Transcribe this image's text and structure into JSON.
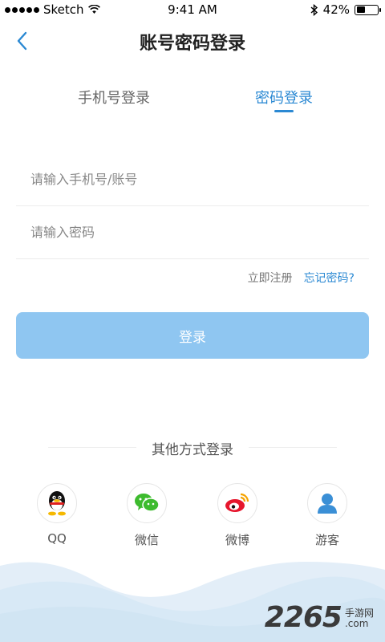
{
  "status_bar": {
    "carrier": "Sketch",
    "time": "9:41 AM",
    "battery": "42%",
    "battery_level": 0.42
  },
  "header": {
    "title": "账号密码登录"
  },
  "tabs": [
    {
      "label": "手机号登录",
      "active": false
    },
    {
      "label": "密码登录",
      "active": true
    }
  ],
  "form": {
    "account_placeholder": "请输入手机号/账号",
    "password_placeholder": "请输入密码",
    "register_label": "立即注册",
    "forgot_label": "忘记密码?",
    "login_label": "登录"
  },
  "other_login": {
    "title": "其他方式登录",
    "options": [
      {
        "label": "QQ",
        "icon": "qq-icon"
      },
      {
        "label": "微信",
        "icon": "wechat-icon"
      },
      {
        "label": "微博",
        "icon": "weibo-icon"
      },
      {
        "label": "游客",
        "icon": "guest-icon"
      }
    ]
  },
  "watermark": {
    "number": "2265",
    "text": [
      "手游网",
      ".com"
    ]
  },
  "colors": {
    "accent": "#2b89d3",
    "button": "#8fc6f1",
    "wave": "#dbeaf6"
  }
}
